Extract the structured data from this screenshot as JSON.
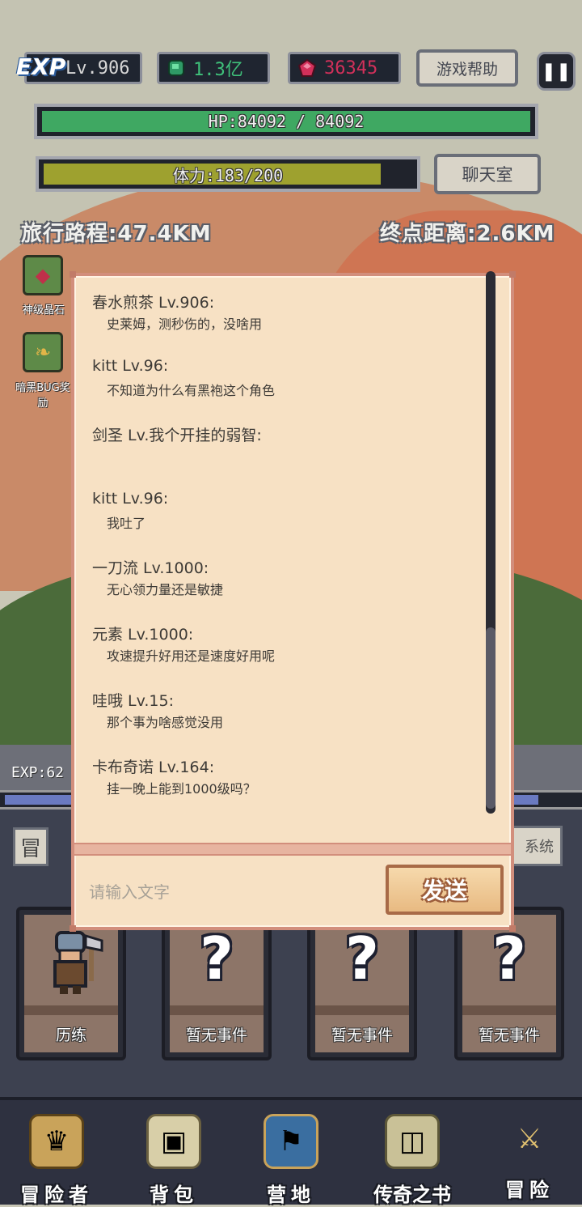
{
  "hud": {
    "exp_logo": "EXP",
    "level": "Lv.906",
    "green_currency": "1.3亿",
    "red_currency": "36345",
    "help_button": "游戏帮助",
    "pause_icon": "pause-icon",
    "hp_text": "HP:84092 / 84092",
    "hp_fraction": 1.0,
    "stamina_text": "体力:183/200",
    "stamina_fraction": 0.915,
    "chat_button": "聊天室",
    "travel_distance": "旅行路程:47.4KM",
    "remaining_distance": "终点距离:2.6KM",
    "colors": {
      "hp": "#3fa862",
      "stamina": "#9ea12f",
      "gem_green": "#2f9a66",
      "gem_red": "#d2305a"
    }
  },
  "side_items": [
    {
      "label": "神级晶石",
      "icon": "meat-crystal-icon"
    },
    {
      "label": "暗黑BUG奖励",
      "icon": "horn-icon"
    }
  ],
  "exp_small": "EXP:62",
  "system_button": "系统",
  "tab_left": "冒",
  "chat": {
    "messages": [
      {
        "name": "春水煎茶 Lv.906:",
        "text": "史莱姆，测秒伤的，没啥用"
      },
      {
        "name": "kitt Lv.96:",
        "text": "不知道为什么有黑袍这个角色"
      },
      {
        "name": "剑圣 Lv.我个开挂的弱智:",
        "text": ""
      },
      {
        "name": "kitt Lv.96:",
        "text": "我吐了"
      },
      {
        "name": "一刀流 Lv.1000:",
        "text": "无心领力量还是敏捷"
      },
      {
        "name": "元素 Lv.1000:",
        "text": "攻速提升好用还是速度好用呢"
      },
      {
        "name": "哇哦 Lv.15:",
        "text": "那个事为啥感觉没用"
      },
      {
        "name": "卡布奇诺 Lv.164:",
        "text": "挂一晚上能到1000级吗？"
      }
    ],
    "input_placeholder": "请输入文字",
    "send_button": "发送"
  },
  "cards": [
    {
      "label": "历练",
      "icon": "warrior-icon"
    },
    {
      "label": "暂无事件",
      "icon": "question-icon"
    },
    {
      "label": "暂无事件",
      "icon": "question-icon"
    },
    {
      "label": "暂无事件",
      "icon": "question-icon"
    }
  ],
  "bottom_nav": [
    {
      "label": "冒险者",
      "icon": "helmet-icon"
    },
    {
      "label": "背包",
      "icon": "backpack-icon"
    },
    {
      "label": "营地",
      "icon": "camp-banner-icon"
    },
    {
      "label": "传奇之书",
      "icon": "book-icon"
    },
    {
      "label": "冒险",
      "icon": "sword-icon"
    }
  ]
}
